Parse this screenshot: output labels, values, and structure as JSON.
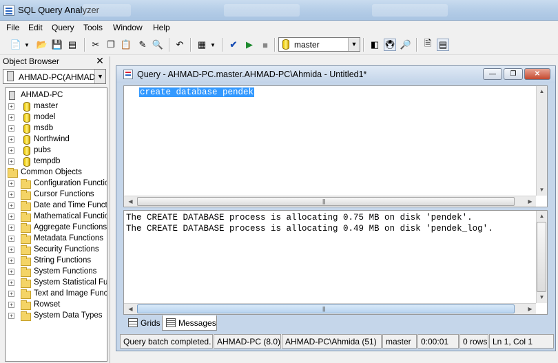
{
  "app": {
    "title": "SQL Query Analyzer"
  },
  "menu": [
    "File",
    "Edit",
    "Query",
    "Tools",
    "Window",
    "Help"
  ],
  "toolbar": {
    "database_selected": "master"
  },
  "object_browser": {
    "title": "Object Browser",
    "server_combo": "AHMAD-PC(AHMAD-PC",
    "server": "AHMAD-PC",
    "databases": [
      "master",
      "model",
      "msdb",
      "Northwind",
      "pubs",
      "tempdb"
    ],
    "common_objects_label": "Common Objects",
    "common_objects": [
      "Configuration Functions",
      "Cursor Functions",
      "Date and Time Functions",
      "Mathematical Functions",
      "Aggregate Functions",
      "Metadata Functions",
      "Security Functions",
      "String Functions",
      "System Functions",
      "System Statistical Functions",
      "Text and Image Functions",
      "Rowset",
      "System Data Types"
    ]
  },
  "query_window": {
    "title": "Query - AHMAD-PC.master.AHMAD-PC\\Ahmida - Untitled1*",
    "editor_text": "create database pendek",
    "messages": [
      "The CREATE DATABASE process is allocating 0.75 MB on disk 'pendek'.",
      "The CREATE DATABASE process is allocating 0.49 MB on disk 'pendek_log'."
    ],
    "tabs": [
      "Grids",
      "Messages"
    ],
    "active_tab": "Messages"
  },
  "status_bar": {
    "message": "Query batch completed.",
    "server": "AHMAD-PC (8.0)",
    "user": "AHMAD-PC\\Ahmida (51)",
    "database": "master",
    "elapsed": "0:00:01",
    "rows": "0 rows",
    "position": "Ln 1, Col 1"
  }
}
